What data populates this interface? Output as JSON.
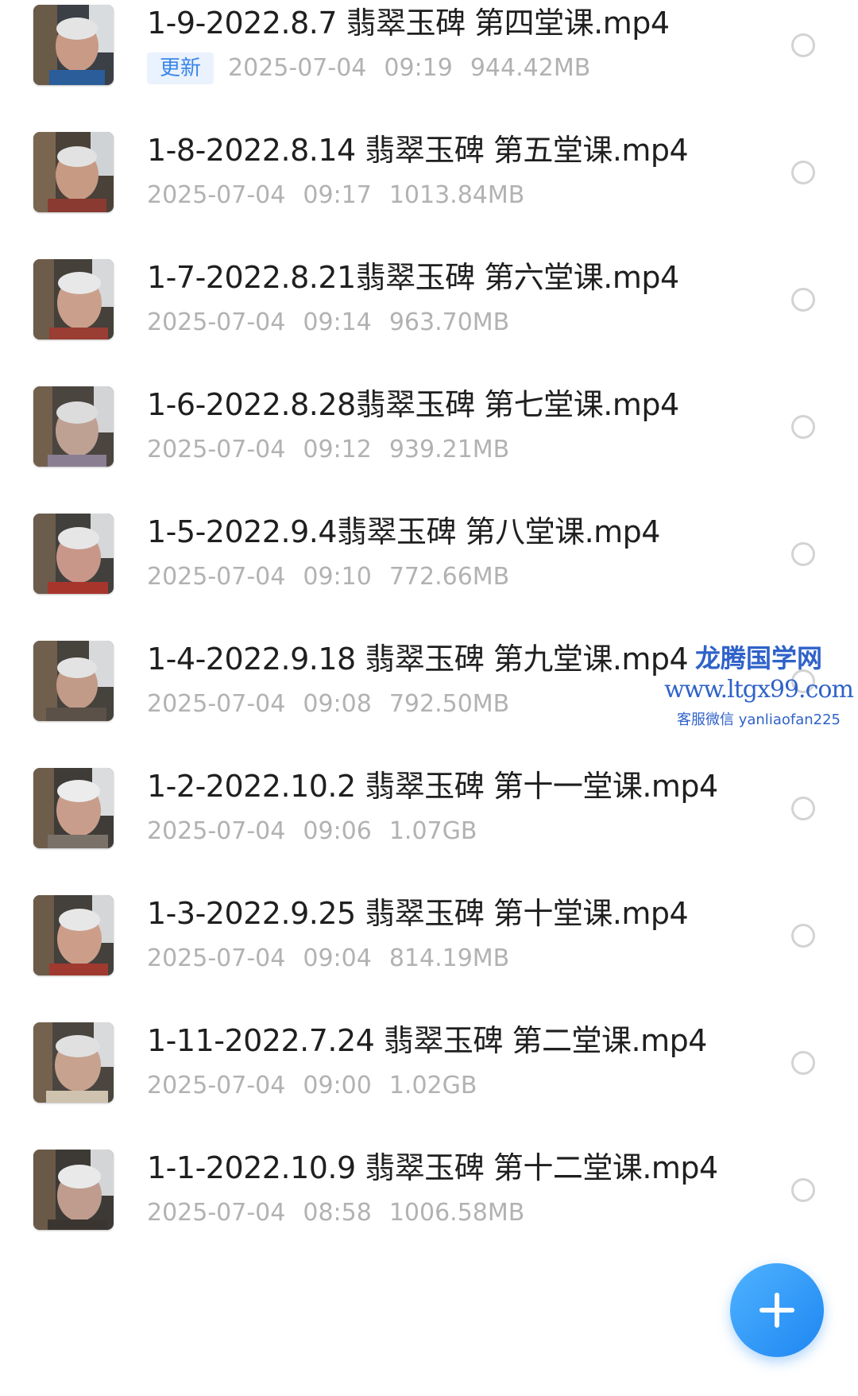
{
  "files": [
    {
      "name": "1-9-2022.8.7 翡翠玉碑 第四堂课.mp4",
      "badge": "更新",
      "date": "2025-07-04",
      "time": "09:19",
      "size": "944.42MB"
    },
    {
      "name": "1-8-2022.8.14 翡翠玉碑 第五堂课.mp4",
      "badge": "",
      "date": "2025-07-04",
      "time": "09:17",
      "size": "1013.84MB"
    },
    {
      "name": "1-7-2022.8.21翡翠玉碑 第六堂课.mp4",
      "badge": "",
      "date": "2025-07-04",
      "time": "09:14",
      "size": "963.70MB"
    },
    {
      "name": "1-6-2022.8.28翡翠玉碑 第七堂课.mp4",
      "badge": "",
      "date": "2025-07-04",
      "time": "09:12",
      "size": "939.21MB"
    },
    {
      "name": "1-5-2022.9.4翡翠玉碑 第八堂课.mp4",
      "badge": "",
      "date": "2025-07-04",
      "time": "09:10",
      "size": "772.66MB"
    },
    {
      "name": "1-4-2022.9.18 翡翠玉碑 第九堂课.mp4",
      "badge": "",
      "date": "2025-07-04",
      "time": "09:08",
      "size": "792.50MB"
    },
    {
      "name": "1-2-2022.10.2 翡翠玉碑 第十一堂课.mp4",
      "badge": "",
      "date": "2025-07-04",
      "time": "09:06",
      "size": "1.07GB"
    },
    {
      "name": "1-3-2022.9.25 翡翠玉碑 第十堂课.mp4",
      "badge": "",
      "date": "2025-07-04",
      "time": "09:04",
      "size": "814.19MB"
    },
    {
      "name": "1-11-2022.7.24 翡翠玉碑 第二堂课.mp4",
      "badge": "",
      "date": "2025-07-04",
      "time": "09:00",
      "size": "1.02GB"
    },
    {
      "name": "1-1-2022.10.9 翡翠玉碑 第十二堂课.mp4",
      "badge": "",
      "date": "2025-07-04",
      "time": "08:58",
      "size": "1006.58MB"
    }
  ],
  "watermark": {
    "title": "龙腾国学网",
    "url": "www.ltgx99.com",
    "contact": "客服微信 yanliaofan225"
  },
  "fab": {
    "icon": "plus-icon"
  },
  "colors": {
    "accent": "#1e86f2",
    "badge_bg": "#eaf2fd",
    "badge_text": "#3a86e9",
    "meta": "#b2b2b2",
    "watermark": "#2f62c9"
  }
}
